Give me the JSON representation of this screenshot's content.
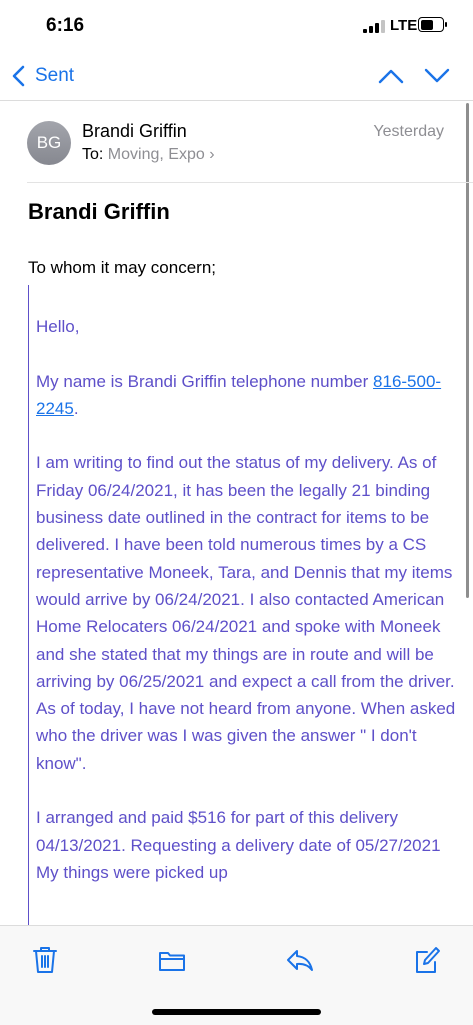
{
  "status_bar": {
    "time": "6:16",
    "network": "LTE"
  },
  "nav": {
    "back_label": "Sent"
  },
  "header": {
    "avatar_initials": "BG",
    "sender": "Brandi Griffin",
    "to_label": "To:",
    "recipients": "Moving, Expo",
    "date": "Yesterday"
  },
  "email": {
    "subject": "Brandi Griffin",
    "greeting": "To whom it may concern;",
    "quote_hello": "Hello,",
    "intro_text": "My name is Brandi Griffin telephone number ",
    "phone": "816-500-2245",
    "intro_end": ".",
    "para1": "I am writing to find out the status of my delivery. As of Friday 06/24/2021, it has been the legally 21 binding business date outlined in the contract for items to be delivered. I have been told numerous times by a CS representative Moneek, Tara, and Dennis that my items would arrive by 06/24/2021. I also contacted American Home Relocaters 06/24/2021 and spoke with Moneek and she stated that my things are in route and will be arriving by 06/25/2021 and expect a call from the driver. As of today, I have not heard from anyone. When asked who the driver was I was given the answer \" I don't know\".",
    "para2": "I arranged and paid $516 for part of this delivery 04/13/2021. Requesting a delivery date of 05/27/2021 My things were picked up"
  },
  "colors": {
    "accent": "#1a73e8",
    "quote": "#5e50c9"
  },
  "icons": [
    "chevron-left-icon",
    "chevron-up-icon",
    "chevron-down-icon",
    "trash-icon",
    "folder-icon",
    "reply-icon",
    "compose-icon"
  ]
}
